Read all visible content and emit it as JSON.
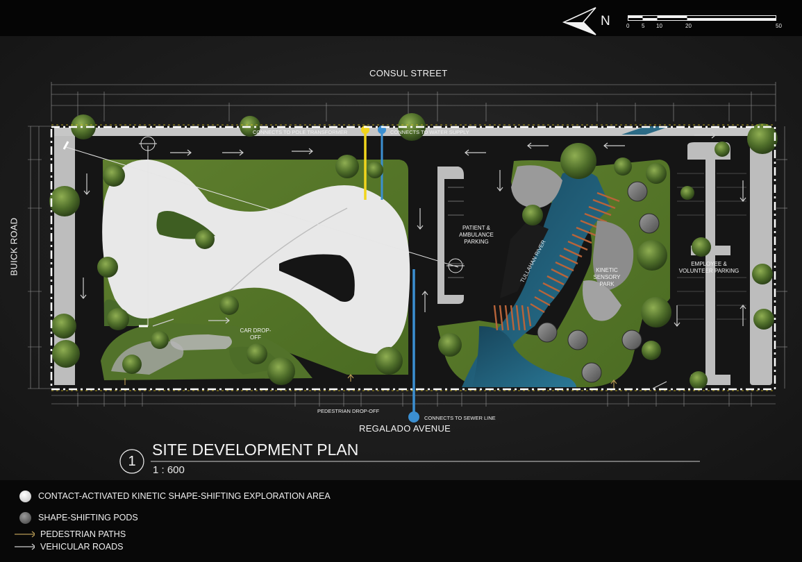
{
  "north": {
    "label": "N",
    "icon": "north-arrow-icon"
  },
  "scale_bar": {
    "ticks": [
      "0",
      "5",
      "10",
      "20",
      "50"
    ]
  },
  "streets": {
    "north": "CONSUL STREET",
    "west": "BUICK ROAD",
    "south": "REGALADO AVENUE"
  },
  "utilities": {
    "pole": "CONNECTS TO POLE TRANSFORMER",
    "water": "CONNECTS TO WATER SUPPLY",
    "sewer": "CONNECTS TO SEWER LINE"
  },
  "zones": {
    "patient": "PATIENT & AMBULANCE PARKING",
    "river": "TULLAHAN RIVER",
    "kinetic_park": "KINETIC SENSORY PARK",
    "employee": "EMPLOYEE & VOLUNTEER PARKING",
    "car_dropoff": "CAR DROP-OFF",
    "pedestrian_dropoff": "PEDESTRIAN DROP-OFF"
  },
  "title": {
    "number": "1",
    "name": "SITE DEVELOPMENT PLAN",
    "scale": "1 : 600"
  },
  "legend": [
    {
      "label": "CONTACT-ACTIVATED KINETIC SHAPE-SHIFTING EXPLORATION AREA",
      "icon": "white-circle-icon",
      "color": "#e6e6e6"
    },
    {
      "label": "SHAPE-SHIFTING PODS",
      "icon": "gray-circle-icon",
      "color": "#6a6a6a"
    },
    {
      "label": "PEDESTRIAN PATHS",
      "icon": "pedestrian-arrow-icon",
      "color": "#b79a55"
    },
    {
      "label": "VEHICULAR ROADS",
      "icon": "vehicle-arrow-icon",
      "color": "#cfcfcf"
    }
  ],
  "colors": {
    "lawn": "#5a7a2a",
    "road": "#141414",
    "river": "#1f5f7a",
    "walkway": "#d9d9d9",
    "power": "#f1d51c",
    "water": "#3b8fd1"
  }
}
